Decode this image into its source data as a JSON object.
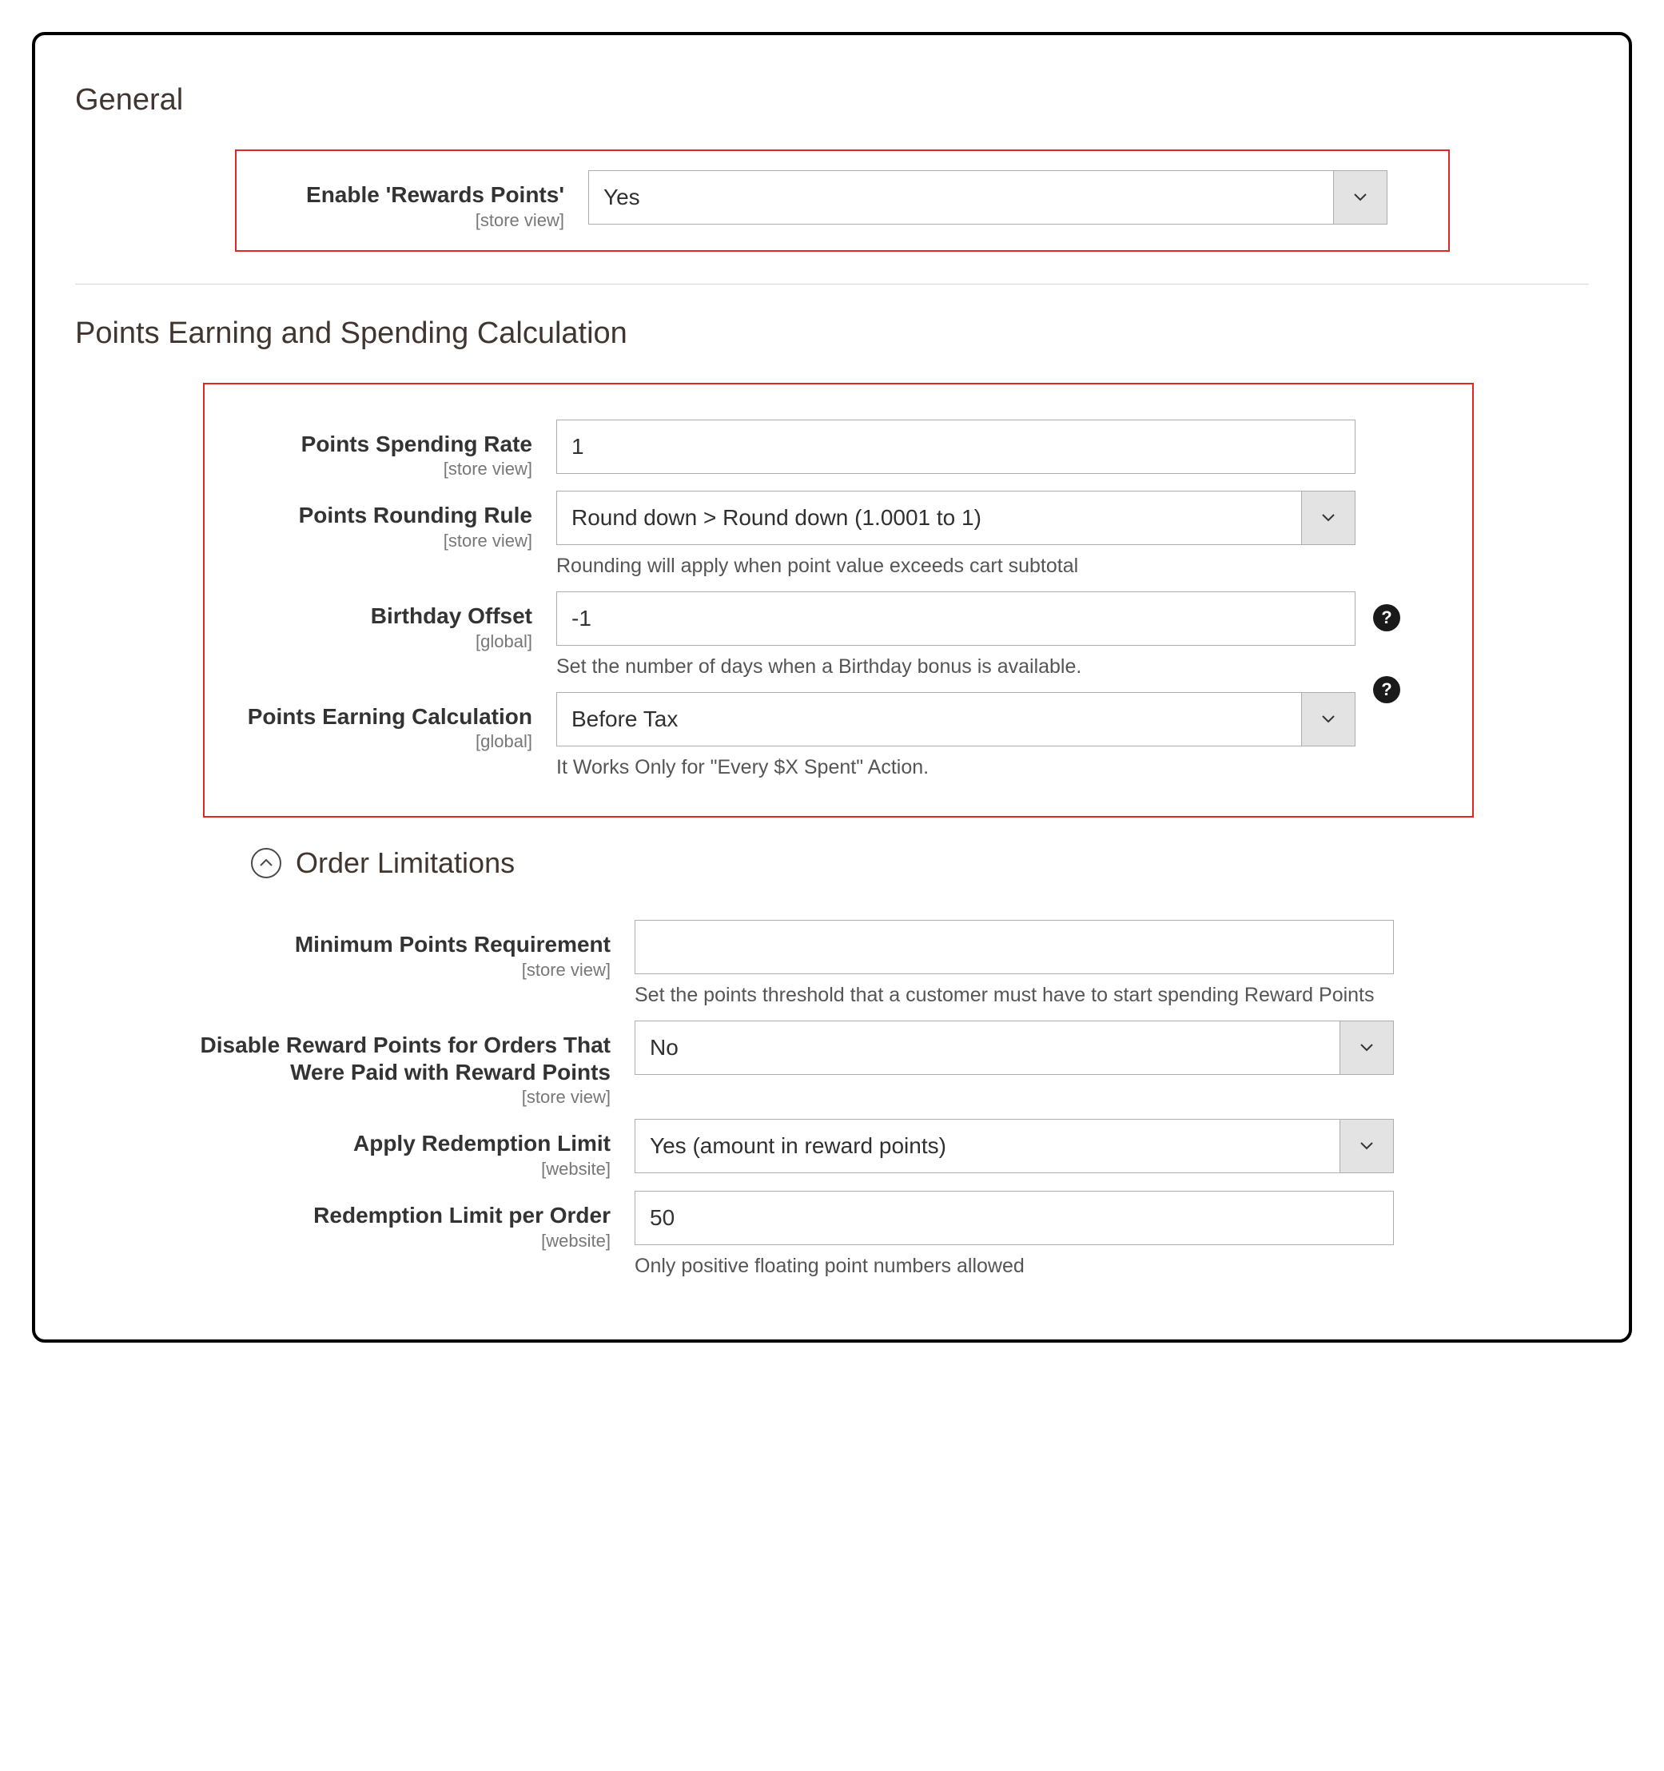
{
  "general": {
    "title": "General",
    "enable_label": "Enable 'Rewards Points'",
    "enable_scope": "[store view]",
    "enable_value": "Yes"
  },
  "calc": {
    "title": "Points Earning and Spending Calculation",
    "spending_rate_label": "Points Spending Rate",
    "spending_rate_scope": "[store view]",
    "spending_rate_value": "1",
    "rounding_label": "Points Rounding Rule",
    "rounding_scope": "[store view]",
    "rounding_value": "Round down > Round down (1.0001 to 1)",
    "rounding_note": "Rounding will apply when point value exceeds cart subtotal",
    "birthday_label": "Birthday Offset",
    "birthday_scope": "[global]",
    "birthday_value": "-1",
    "birthday_note": "Set the number of days when a Birthday bonus is available.",
    "earning_label": "Points Earning Calculation",
    "earning_scope": "[global]",
    "earning_value": "Before Tax",
    "earning_note": "It Works Only for \"Every $X Spent\" Action."
  },
  "limits": {
    "title": "Order Limitations",
    "min_points_label": "Minimum Points Requirement",
    "min_points_scope": "[store view]",
    "min_points_value": "",
    "min_points_note": "Set the points threshold that a customer must have to start spending Reward Points",
    "disable_label": "Disable Reward Points for Orders That Were Paid with Reward Points",
    "disable_scope": "[store view]",
    "disable_value": "No",
    "redemption_limit_label": "Apply Redemption Limit",
    "redemption_limit_scope": "[website]",
    "redemption_limit_value": "Yes (amount in reward points)",
    "redemption_per_order_label": "Redemption Limit per Order",
    "redemption_per_order_scope": "[website]",
    "redemption_per_order_value": "50",
    "redemption_per_order_note": "Only positive floating point numbers allowed"
  },
  "glyphs": {
    "help": "?"
  }
}
